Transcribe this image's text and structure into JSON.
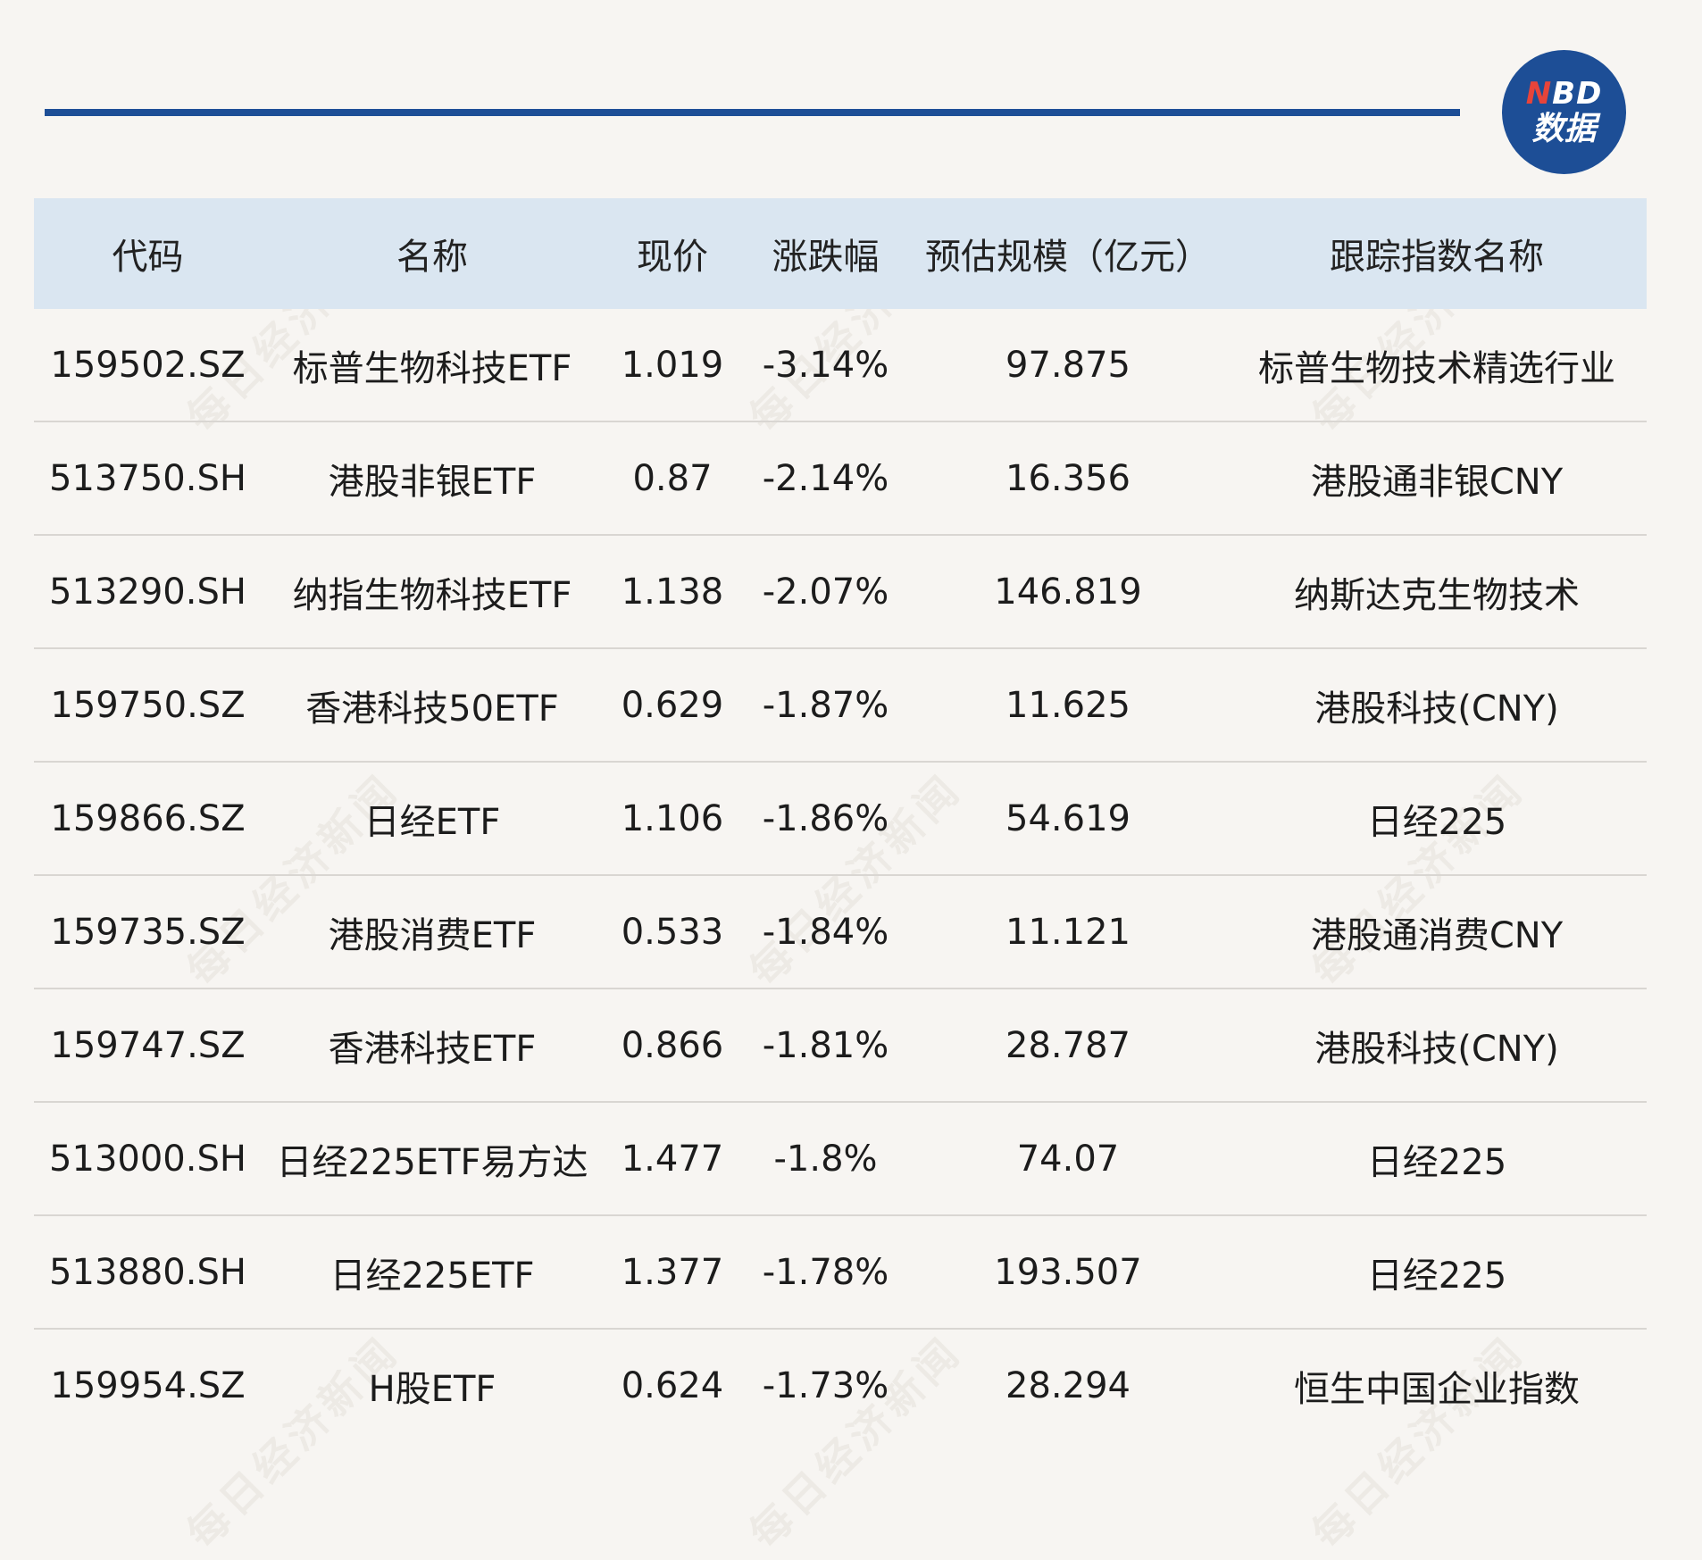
{
  "brand": {
    "logo_line1_accent": "N",
    "logo_line1_rest": "BD",
    "logo_line2": "数据"
  },
  "watermark_text": "每日经济新闻",
  "table": {
    "headers": [
      "代码",
      "名称",
      "现价",
      "涨跌幅",
      "预估规模（亿元）",
      "跟踪指数名称"
    ],
    "rows": [
      [
        "159502.SZ",
        "标普生物科技ETF",
        "1.019",
        "-3.14%",
        "97.875",
        "标普生物技术精选行业"
      ],
      [
        "513750.SH",
        "港股非银ETF",
        "0.87",
        "-2.14%",
        "16.356",
        "港股通非银CNY"
      ],
      [
        "513290.SH",
        "纳指生物科技ETF",
        "1.138",
        "-2.07%",
        "146.819",
        "纳斯达克生物技术"
      ],
      [
        "159750.SZ",
        "香港科技50ETF",
        "0.629",
        "-1.87%",
        "11.625",
        "港股科技(CNY)"
      ],
      [
        "159866.SZ",
        "日经ETF",
        "1.106",
        "-1.86%",
        "54.619",
        "日经225"
      ],
      [
        "159735.SZ",
        "港股消费ETF",
        "0.533",
        "-1.84%",
        "11.121",
        "港股通消费CNY"
      ],
      [
        "159747.SZ",
        "香港科技ETF",
        "0.866",
        "-1.81%",
        "28.787",
        "港股科技(CNY)"
      ],
      [
        "513000.SH",
        "日经225ETF易方达",
        "1.477",
        "-1.8%",
        "74.07",
        "日经225"
      ],
      [
        "513880.SH",
        "日经225ETF",
        "1.377",
        "-1.78%",
        "193.507",
        "日经225"
      ],
      [
        "159954.SZ",
        "H股ETF",
        "0.624",
        "-1.73%",
        "28.294",
        "恒生中国企业指数"
      ]
    ]
  },
  "colors": {
    "rule": "#1d4e96",
    "header_bg": "#dae6f1",
    "page_bg": "#f7f5f2",
    "logo_accent": "#e8443a"
  }
}
